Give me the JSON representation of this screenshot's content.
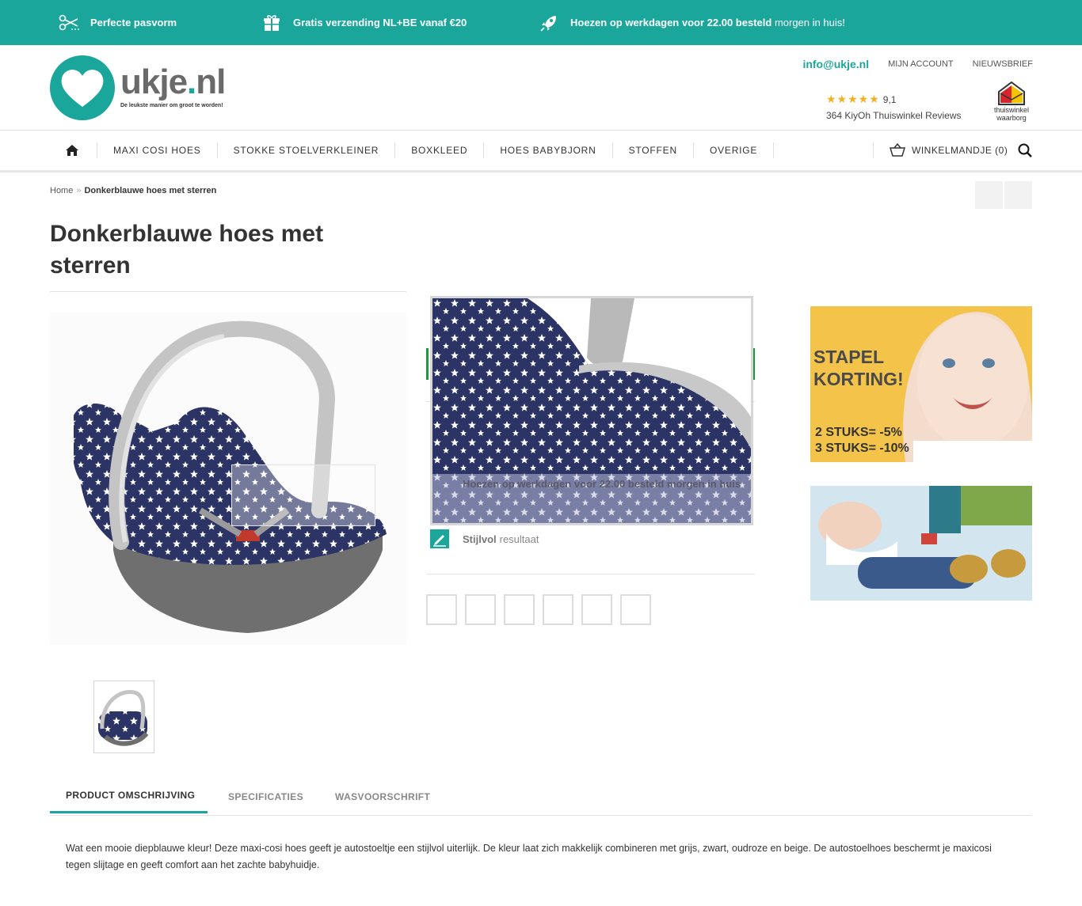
{
  "topbar": {
    "usp1": {
      "label": "Perfecte pasvorm",
      "icon": "scissors-icon"
    },
    "usp2": {
      "label": "Gratis verzending NL+BE vanaf €20",
      "icon": "gift-icon"
    },
    "usp3": {
      "label_bold": "Hoezen op werkdagen voor 22.00 besteld",
      "label_light": "morgen in huis!",
      "icon": "rocket-icon"
    }
  },
  "header": {
    "logo_text": "ukje",
    "logo_dot": ".",
    "logo_tld": "nl",
    "logo_tagline": "De leukste manier om groot te worden!",
    "email": "info@ukje.nl",
    "account": "MIJN ACCOUNT",
    "newsletter": "NIEUWSBRIEF",
    "rating_stars": "★★★★★",
    "rating_score": "9,1",
    "rating_count": "364 KiyOh Thuiswinkel Reviews",
    "trust_logo_text_1": "thuiswinkel",
    "trust_logo_text_2": "waarborg"
  },
  "nav": {
    "items": [
      "MAXI COSI HOES",
      "STOKKE STOELVERKLEINER",
      "BOXKLEED",
      "HOES BABYBJORN",
      "STOFFEN",
      "OVERIGE"
    ],
    "cart_label": "WINKELMANDJE (0)"
  },
  "breadcrumb": {
    "home": "Home",
    "sep": "»",
    "current": "Donkerblauwe hoes met sterren"
  },
  "product": {
    "title": "Donkerblauwe hoes met sterren",
    "zoom_usp": "Hoezen op werkdagen voor 22.00 besteld morgen in huis",
    "benefit_bold": "Stijlvol",
    "benefit_rest": "resultaat"
  },
  "banners": {
    "stapel_title_1": "STAPEL",
    "stapel_title_2": "KORTING!",
    "stapel_line_1": "2 STUKS= -5%",
    "stapel_line_2": "3 STUKS= -10%"
  },
  "tabs": [
    "PRODUCT OMSCHRIJVING",
    "SPECIFICATIES",
    "WASVOORSCHRIFT"
  ],
  "description": "Wat een mooie diepblauwe kleur! Deze maxi-cosi hoes geeft je autostoeltje een stijlvol uiterlijk. De kleur laat zich makkelijk combineren met grijs, zwart, oudroze en beige. De autostoelhoes beschermt je maxicosi tegen slijtage en geeft comfort aan het zachte babyhuidje.",
  "colors": {
    "brand": "#1aa69a",
    "navy": "#2c3466",
    "star": "#f2b01e"
  }
}
